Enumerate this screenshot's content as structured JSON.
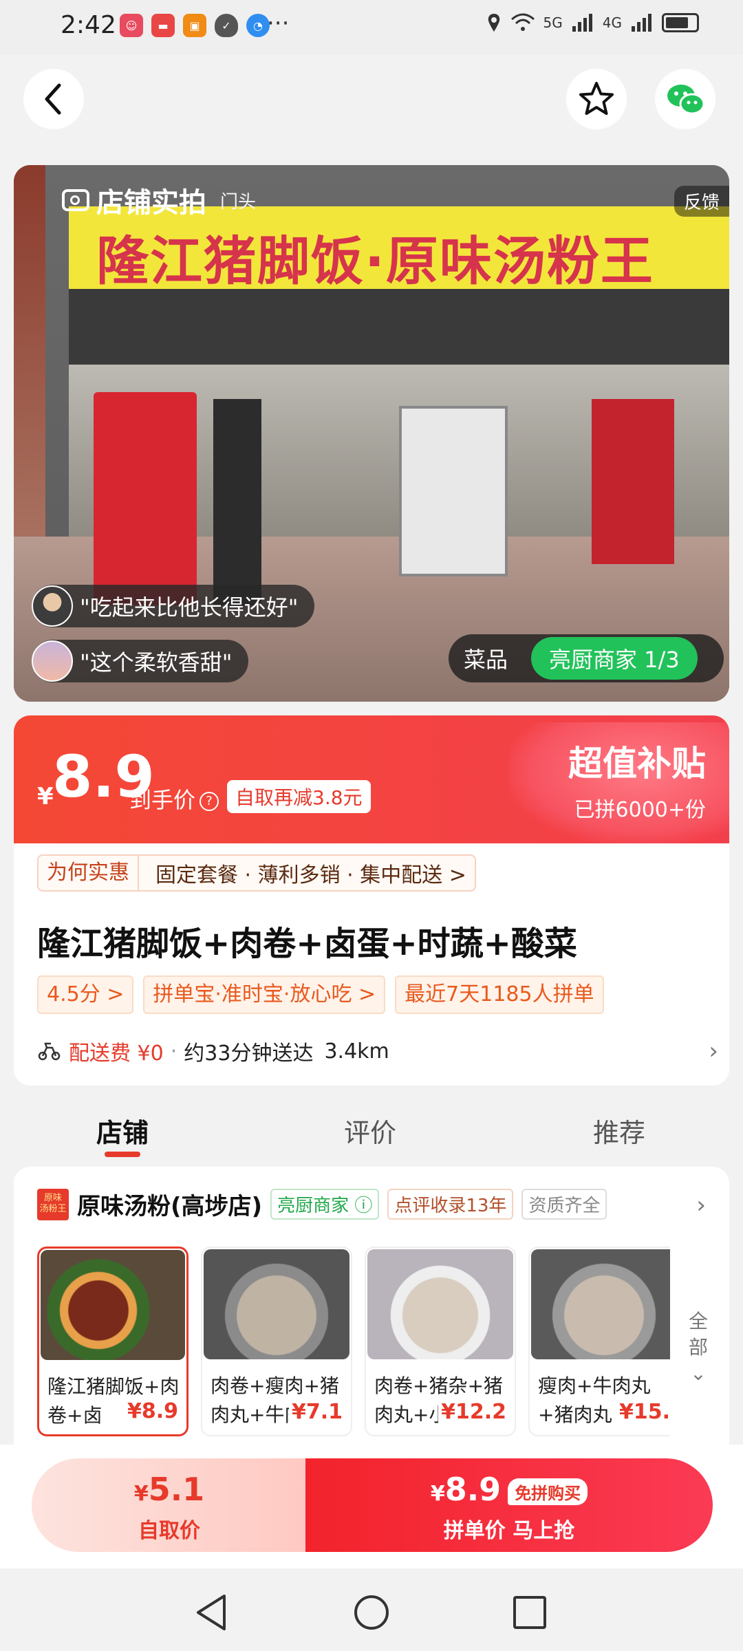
{
  "status_bar": {
    "time": "2:42",
    "more": "···",
    "signal_5g": "5G",
    "signal_4g": "4G"
  },
  "hero": {
    "store_sign": "隆江猪脚饭·原味汤粉王",
    "caption_title": "店铺实拍",
    "caption_sub": "门头",
    "feedback": "反馈",
    "review_bubble_1": "\"吃起来比他长得还好\"",
    "review_bubble_2": "\"这个柔软香甜\"",
    "tab_dish": "菜品",
    "tab_kitchen": "亮厨商家 1/3"
  },
  "price": {
    "yen": "¥",
    "value": "8.9",
    "label": "到手价",
    "pickup_badge": "自取再减3.8元",
    "subsidy_title": "超值补贴",
    "subsidy_sub": "已拼6000+份"
  },
  "why": {
    "label": "为何实惠",
    "reasons": "固定套餐 · 薄利多销 · 集中配送 >"
  },
  "dish": {
    "title": "隆江猪脚饭+肉卷+卤蛋+时蔬+酸菜",
    "tags": [
      "4.5分 >",
      "拼单宝·准时宝·放心吃 >",
      "最近7天1185人拼单"
    ]
  },
  "delivery": {
    "fee": "配送费 ¥0",
    "time": "约33分钟送达",
    "distance": "3.4km"
  },
  "tabs": [
    "店铺",
    "评价",
    "推荐"
  ],
  "store": {
    "logo_line1": "原味",
    "logo_line2": "汤粉王",
    "name": "原味汤粉(高埗店)",
    "tag_green": "亮厨商家 ⓘ",
    "tag_orange": "点评收录13年",
    "tag_gray": "资质齐全",
    "more_label_1": "全",
    "more_label_2": "部",
    "products": [
      {
        "name": "隆江猪脚饭+肉卷+卤",
        "price": "¥8.9"
      },
      {
        "name": "肉卷+瘦肉+猪肉丸+牛肉",
        "price": "¥7.1"
      },
      {
        "name": "肉卷+猪杂+猪肉丸+小",
        "price": "¥12.2"
      },
      {
        "name": "瘦肉+牛肉丸+猪肉丸",
        "price": "¥15."
      }
    ]
  },
  "bottom": {
    "self_yen": "¥",
    "self_price": "5.1",
    "self_label": "自取价",
    "group_yen": "¥",
    "group_price": "8.9",
    "group_badge": "免拼购买",
    "group_label": "拼单价 马上抢"
  }
}
